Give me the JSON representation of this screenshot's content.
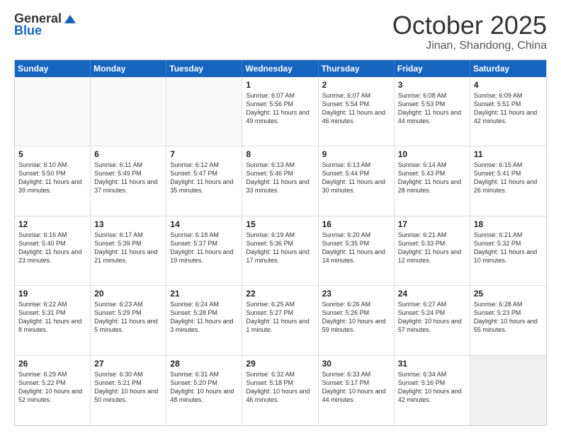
{
  "header": {
    "logo_general": "General",
    "logo_blue": "Blue",
    "month_title": "October 2025",
    "location": "Jinan, Shandong, China"
  },
  "calendar": {
    "days_of_week": [
      "Sunday",
      "Monday",
      "Tuesday",
      "Wednesday",
      "Thursday",
      "Friday",
      "Saturday"
    ],
    "rows": [
      [
        {
          "day": "",
          "text": "",
          "empty": true
        },
        {
          "day": "",
          "text": "",
          "empty": true
        },
        {
          "day": "",
          "text": "",
          "empty": true
        },
        {
          "day": "1",
          "text": "Sunrise: 6:07 AM\nSunset: 5:56 PM\nDaylight: 11 hours and 49 minutes."
        },
        {
          "day": "2",
          "text": "Sunrise: 6:07 AM\nSunset: 5:54 PM\nDaylight: 11 hours and 46 minutes."
        },
        {
          "day": "3",
          "text": "Sunrise: 6:08 AM\nSunset: 5:53 PM\nDaylight: 11 hours and 44 minutes."
        },
        {
          "day": "4",
          "text": "Sunrise: 6:09 AM\nSunset: 5:51 PM\nDaylight: 11 hours and 42 minutes."
        }
      ],
      [
        {
          "day": "5",
          "text": "Sunrise: 6:10 AM\nSunset: 5:50 PM\nDaylight: 11 hours and 39 minutes."
        },
        {
          "day": "6",
          "text": "Sunrise: 6:11 AM\nSunset: 5:49 PM\nDaylight: 11 hours and 37 minutes."
        },
        {
          "day": "7",
          "text": "Sunrise: 6:12 AM\nSunset: 5:47 PM\nDaylight: 11 hours and 35 minutes."
        },
        {
          "day": "8",
          "text": "Sunrise: 6:13 AM\nSunset: 5:46 PM\nDaylight: 11 hours and 33 minutes."
        },
        {
          "day": "9",
          "text": "Sunrise: 6:13 AM\nSunset: 5:44 PM\nDaylight: 11 hours and 30 minutes."
        },
        {
          "day": "10",
          "text": "Sunrise: 6:14 AM\nSunset: 5:43 PM\nDaylight: 11 hours and 28 minutes."
        },
        {
          "day": "11",
          "text": "Sunrise: 6:15 AM\nSunset: 5:41 PM\nDaylight: 11 hours and 26 minutes."
        }
      ],
      [
        {
          "day": "12",
          "text": "Sunrise: 6:16 AM\nSunset: 5:40 PM\nDaylight: 11 hours and 23 minutes."
        },
        {
          "day": "13",
          "text": "Sunrise: 6:17 AM\nSunset: 5:39 PM\nDaylight: 11 hours and 21 minutes."
        },
        {
          "day": "14",
          "text": "Sunrise: 6:18 AM\nSunset: 5:37 PM\nDaylight: 11 hours and 19 minutes."
        },
        {
          "day": "15",
          "text": "Sunrise: 6:19 AM\nSunset: 5:36 PM\nDaylight: 11 hours and 17 minutes."
        },
        {
          "day": "16",
          "text": "Sunrise: 6:20 AM\nSunset: 5:35 PM\nDaylight: 11 hours and 14 minutes."
        },
        {
          "day": "17",
          "text": "Sunrise: 6:21 AM\nSunset: 5:33 PM\nDaylight: 11 hours and 12 minutes."
        },
        {
          "day": "18",
          "text": "Sunrise: 6:21 AM\nSunset: 5:32 PM\nDaylight: 11 hours and 10 minutes."
        }
      ],
      [
        {
          "day": "19",
          "text": "Sunrise: 6:22 AM\nSunset: 5:31 PM\nDaylight: 11 hours and 8 minutes."
        },
        {
          "day": "20",
          "text": "Sunrise: 6:23 AM\nSunset: 5:29 PM\nDaylight: 11 hours and 5 minutes."
        },
        {
          "day": "21",
          "text": "Sunrise: 6:24 AM\nSunset: 5:28 PM\nDaylight: 11 hours and 3 minutes."
        },
        {
          "day": "22",
          "text": "Sunrise: 6:25 AM\nSunset: 5:27 PM\nDaylight: 11 hours and 1 minute."
        },
        {
          "day": "23",
          "text": "Sunrise: 6:26 AM\nSunset: 5:26 PM\nDaylight: 10 hours and 59 minutes."
        },
        {
          "day": "24",
          "text": "Sunrise: 6:27 AM\nSunset: 5:24 PM\nDaylight: 10 hours and 57 minutes."
        },
        {
          "day": "25",
          "text": "Sunrise: 6:28 AM\nSunset: 5:23 PM\nDaylight: 10 hours and 55 minutes."
        }
      ],
      [
        {
          "day": "26",
          "text": "Sunrise: 6:29 AM\nSunset: 5:22 PM\nDaylight: 10 hours and 52 minutes."
        },
        {
          "day": "27",
          "text": "Sunrise: 6:30 AM\nSunset: 5:21 PM\nDaylight: 10 hours and 50 minutes."
        },
        {
          "day": "28",
          "text": "Sunrise: 6:31 AM\nSunset: 5:20 PM\nDaylight: 10 hours and 48 minutes."
        },
        {
          "day": "29",
          "text": "Sunrise: 6:32 AM\nSunset: 5:18 PM\nDaylight: 10 hours and 46 minutes."
        },
        {
          "day": "30",
          "text": "Sunrise: 6:33 AM\nSunset: 5:17 PM\nDaylight: 10 hours and 44 minutes."
        },
        {
          "day": "31",
          "text": "Sunrise: 6:34 AM\nSunset: 5:16 PM\nDaylight: 10 hours and 42 minutes."
        },
        {
          "day": "",
          "text": "",
          "empty": true
        }
      ]
    ]
  }
}
